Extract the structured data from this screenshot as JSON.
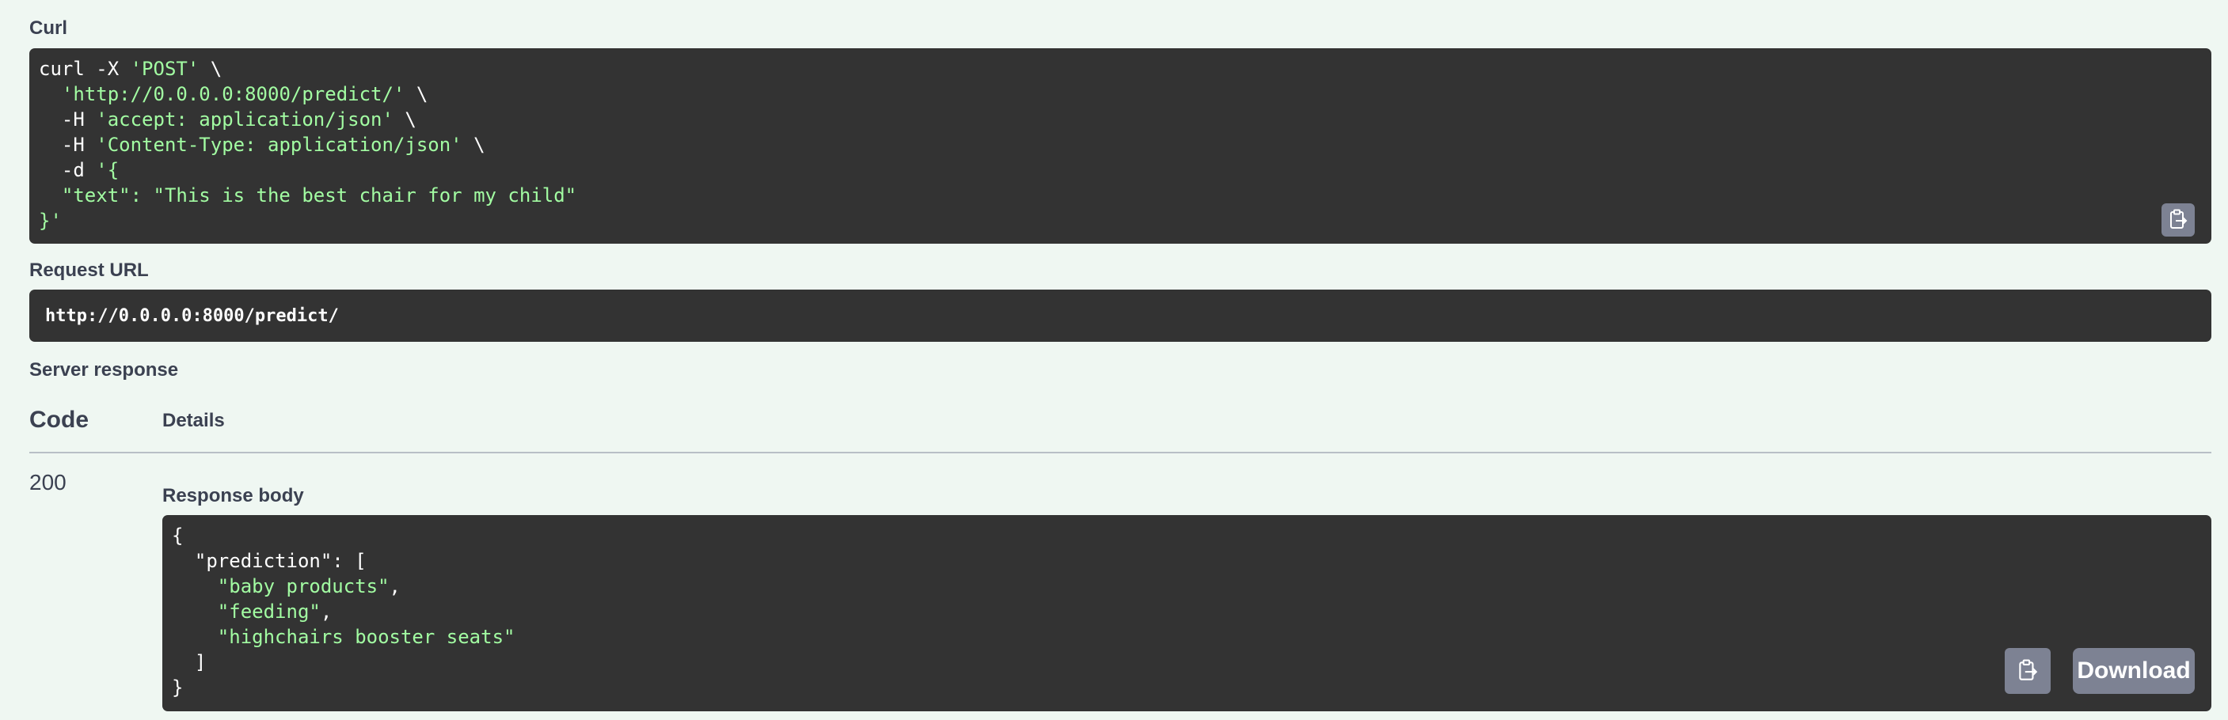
{
  "curl": {
    "label": "Curl",
    "lines": [
      [
        {
          "t": "curl -X ",
          "c": "plain"
        },
        {
          "t": "'POST'",
          "c": "str"
        },
        {
          "t": " \\",
          "c": "plain"
        }
      ],
      [
        {
          "t": "  ",
          "c": "plain"
        },
        {
          "t": "'http://0.0.0.0:8000/predict/'",
          "c": "str"
        },
        {
          "t": " \\",
          "c": "plain"
        }
      ],
      [
        {
          "t": "  -H ",
          "c": "plain"
        },
        {
          "t": "'accept: application/json'",
          "c": "str"
        },
        {
          "t": " \\",
          "c": "plain"
        }
      ],
      [
        {
          "t": "  -H ",
          "c": "plain"
        },
        {
          "t": "'Content-Type: application/json'",
          "c": "str"
        },
        {
          "t": " \\",
          "c": "plain"
        }
      ],
      [
        {
          "t": "  -d ",
          "c": "plain"
        },
        {
          "t": "'{",
          "c": "str"
        }
      ],
      [
        {
          "t": "  \"text\": \"This is the best chair for my child\"",
          "c": "str"
        }
      ],
      [
        {
          "t": "}'",
          "c": "str"
        }
      ]
    ],
    "copy_icon": "clipboard-icon"
  },
  "request_url": {
    "label": "Request URL",
    "value": "http://0.0.0.0:8000/predict/"
  },
  "server_response": {
    "label": "Server response",
    "col_code": "Code",
    "col_details": "Details",
    "status_code": "200",
    "response_body_label": "Response body",
    "body_lines": [
      [
        {
          "t": "{",
          "c": "plain"
        }
      ],
      [
        {
          "t": "  \"prediction\": [",
          "c": "plain"
        }
      ],
      [
        {
          "t": "    ",
          "c": "plain"
        },
        {
          "t": "\"baby products\"",
          "c": "str"
        },
        {
          "t": ",",
          "c": "plain"
        }
      ],
      [
        {
          "t": "    ",
          "c": "plain"
        },
        {
          "t": "\"feeding\"",
          "c": "str"
        },
        {
          "t": ",",
          "c": "plain"
        }
      ],
      [
        {
          "t": "    ",
          "c": "plain"
        },
        {
          "t": "\"highchairs booster seats\"",
          "c": "str"
        }
      ],
      [
        {
          "t": "  ]",
          "c": "plain"
        }
      ],
      [
        {
          "t": "}",
          "c": "plain"
        }
      ]
    ],
    "copy_icon": "clipboard-icon",
    "download_label": "Download"
  },
  "colors": {
    "page_bg": "#eff7f2",
    "code_bg": "#333333",
    "string_green": "#a2fca2",
    "button_gray": "#7d8293"
  }
}
